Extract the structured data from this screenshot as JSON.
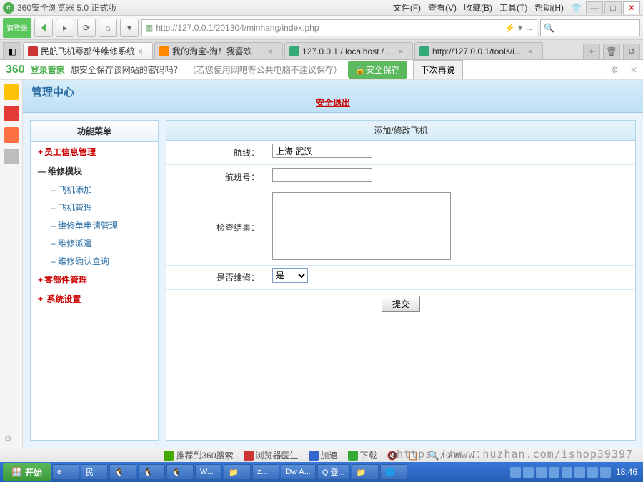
{
  "titlebar": {
    "title": "360安全浏览器 5.0 正式版",
    "menus": [
      "文件(F)",
      "查看(V)",
      "收藏(B)",
      "工具(T)",
      "帮助(H)"
    ]
  },
  "nav": {
    "login": "请登录",
    "url": "http://127.0.0.1/201304/minhang/index.php"
  },
  "tabs": [
    {
      "label": "民航飞机零部件维修系统"
    },
    {
      "label": "我的淘宝-淘！我喜欢"
    },
    {
      "label": "127.0.0.1 / localhost / ..."
    },
    {
      "label": "http://127.0.0.1/tools/i..."
    }
  ],
  "infobar": {
    "logo": "360",
    "logotxt": "登录管家",
    "msg": "想安全保存该网站的密码吗？",
    "note": "（若您使用网吧等公共电脑不建议保存）",
    "save": "🔒安全保存",
    "later": "下次再说"
  },
  "app": {
    "title": "管理中心",
    "logout": "安全退出"
  },
  "menu": {
    "title": "功能菜单",
    "items": [
      {
        "label": "员工信息管理",
        "type": "h"
      },
      {
        "label": "维修模块",
        "type": "h2"
      },
      {
        "label": "飞机添加",
        "type": "s"
      },
      {
        "label": "飞机管理",
        "type": "s"
      },
      {
        "label": "维修单申请管理",
        "type": "s"
      },
      {
        "label": "维修派遣",
        "type": "s"
      },
      {
        "label": "维修确认查询",
        "type": "s"
      },
      {
        "label": "零部件管理",
        "type": "h"
      },
      {
        "label": "系统设置",
        "type": "h"
      }
    ]
  },
  "form": {
    "title": "添加/修改飞机",
    "route_label": "航线：",
    "route_value": "上海 武汉",
    "flight_label": "航班号：",
    "flight_value": "",
    "check_label": "检查结果：",
    "check_value": "",
    "repair_label": "是否维修：",
    "repair_value": "是",
    "submit": "提交"
  },
  "status": {
    "rec": "推荐到360搜索",
    "doctor": "浏览器医生",
    "accel": "加速",
    "down": "下载",
    "mute": "🔇",
    "zoom": "100%"
  },
  "watermark": "https://www.huzhan.com/ishop39397",
  "taskbar": {
    "start": "开始",
    "items": [
      "e",
      "民",
      "",
      "",
      "",
      "W...",
      "",
      "z...",
      "Dw A...",
      "Q 登...",
      "",
      ""
    ],
    "clock": "18:46"
  }
}
